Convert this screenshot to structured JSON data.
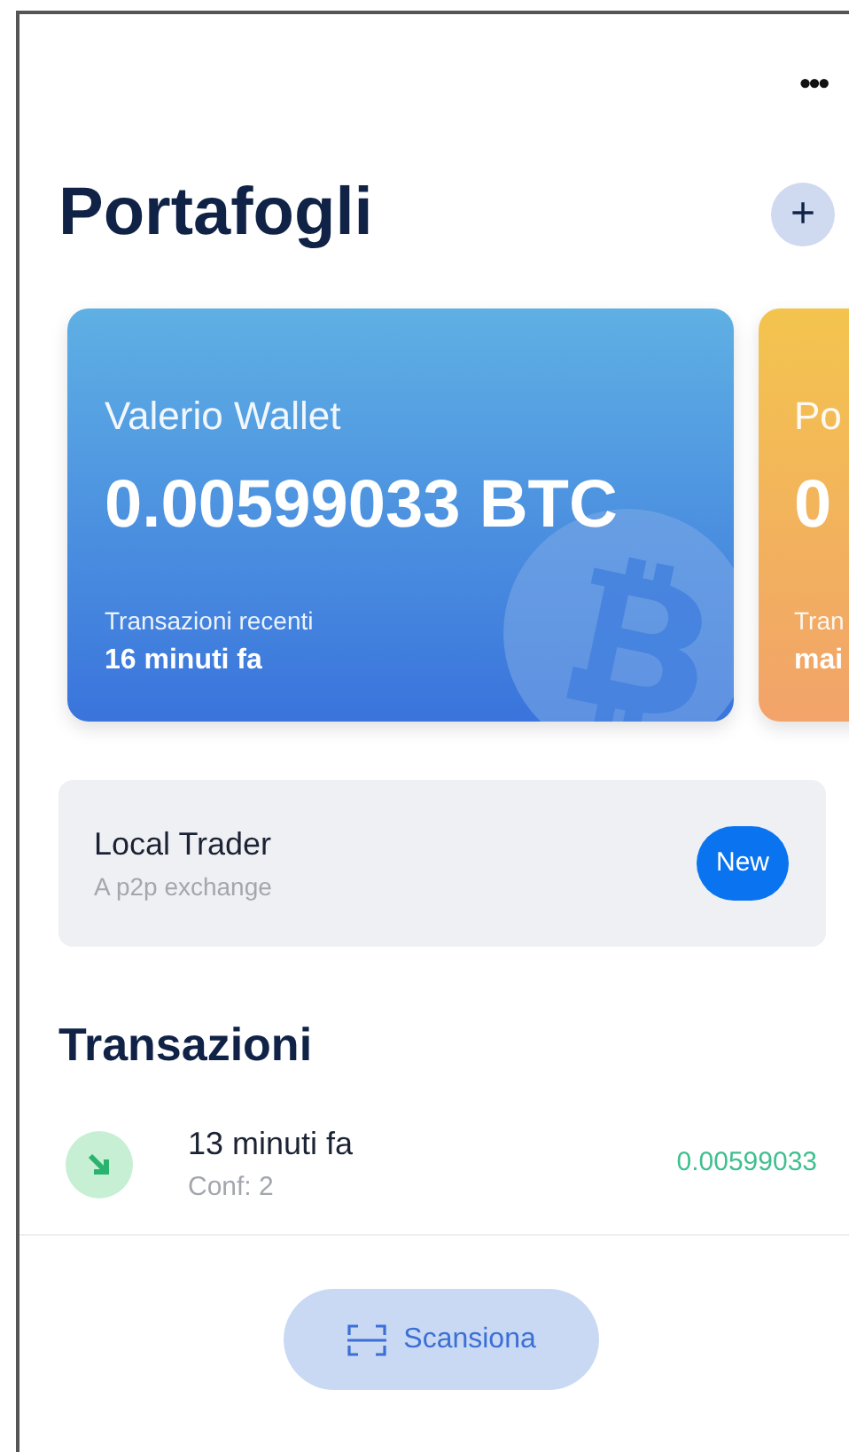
{
  "header": {
    "menu": "•••",
    "title": "Portafogli",
    "add": "+"
  },
  "wallets": [
    {
      "kind": "btc",
      "name": "Valerio Wallet",
      "balance": "0.00599033 BTC",
      "recent_label": "Transazioni recenti",
      "recent": "16 minuti fa"
    },
    {
      "kind": "other",
      "name": "Po",
      "balance": "0",
      "recent_label": "Tran",
      "recent": "mai"
    }
  ],
  "promo": {
    "title": "Local Trader",
    "subtitle": "A p2p exchange",
    "button": "New"
  },
  "transactions_title": "Transazioni",
  "transactions": [
    {
      "incoming": true,
      "time": "13 minuti fa",
      "confirmations": "Conf: 2",
      "amount": "0.00599033"
    }
  ],
  "scan_button": "Scansiona"
}
